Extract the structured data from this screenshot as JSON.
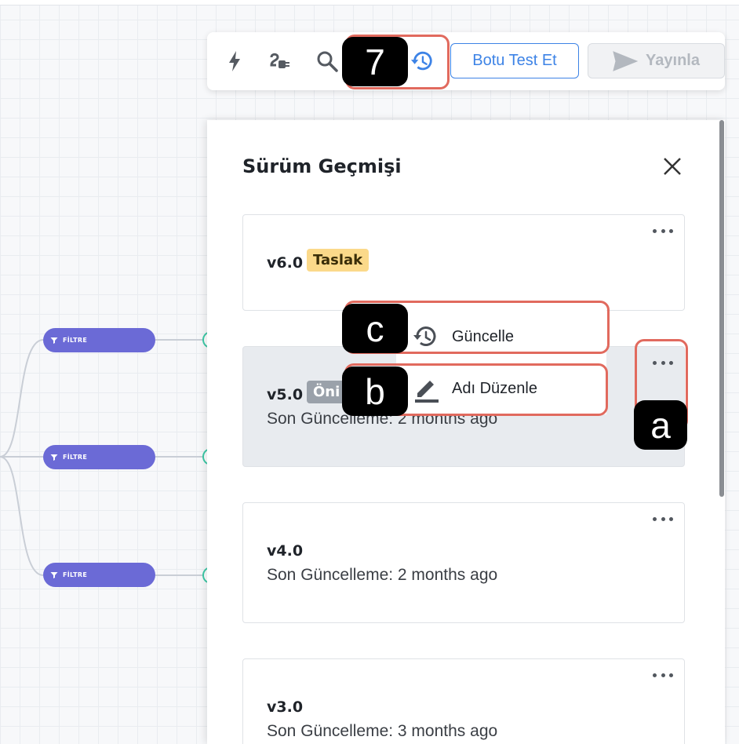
{
  "toolbar": {
    "icons": [
      "flash-icon",
      "plug-icon",
      "search-icon",
      "history-icon"
    ],
    "test_button": "Botu Test Et",
    "publish_button": "Yayınla"
  },
  "canvas": {
    "nodes": [
      {
        "label": "FİLTRE"
      },
      {
        "label": "FİLTRE"
      },
      {
        "label": "FİLTRE"
      }
    ]
  },
  "panel": {
    "title": "Sürüm Geçmişi",
    "versions": [
      {
        "name": "v6.0",
        "badge": "Taslak"
      },
      {
        "name": "v5.0",
        "badge": "Öni",
        "updated": "Son Güncelleme: 2 months ago"
      },
      {
        "name": "v4.0",
        "updated": "Son Güncelleme: 2 months ago"
      },
      {
        "name": "v3.0",
        "updated": "Son Güncelleme: 3 months ago"
      }
    ],
    "menu": {
      "update": "Güncelle",
      "rename": "Adı Düzenle"
    }
  },
  "annotations": {
    "marker_7": "7",
    "marker_a": "a",
    "marker_b": "b",
    "marker_c": "c"
  },
  "colors": {
    "accent": "#3d83e6",
    "node": "#6b6ad6",
    "highlight": "#e16a5e",
    "draft_badge": "#fbd98a"
  }
}
